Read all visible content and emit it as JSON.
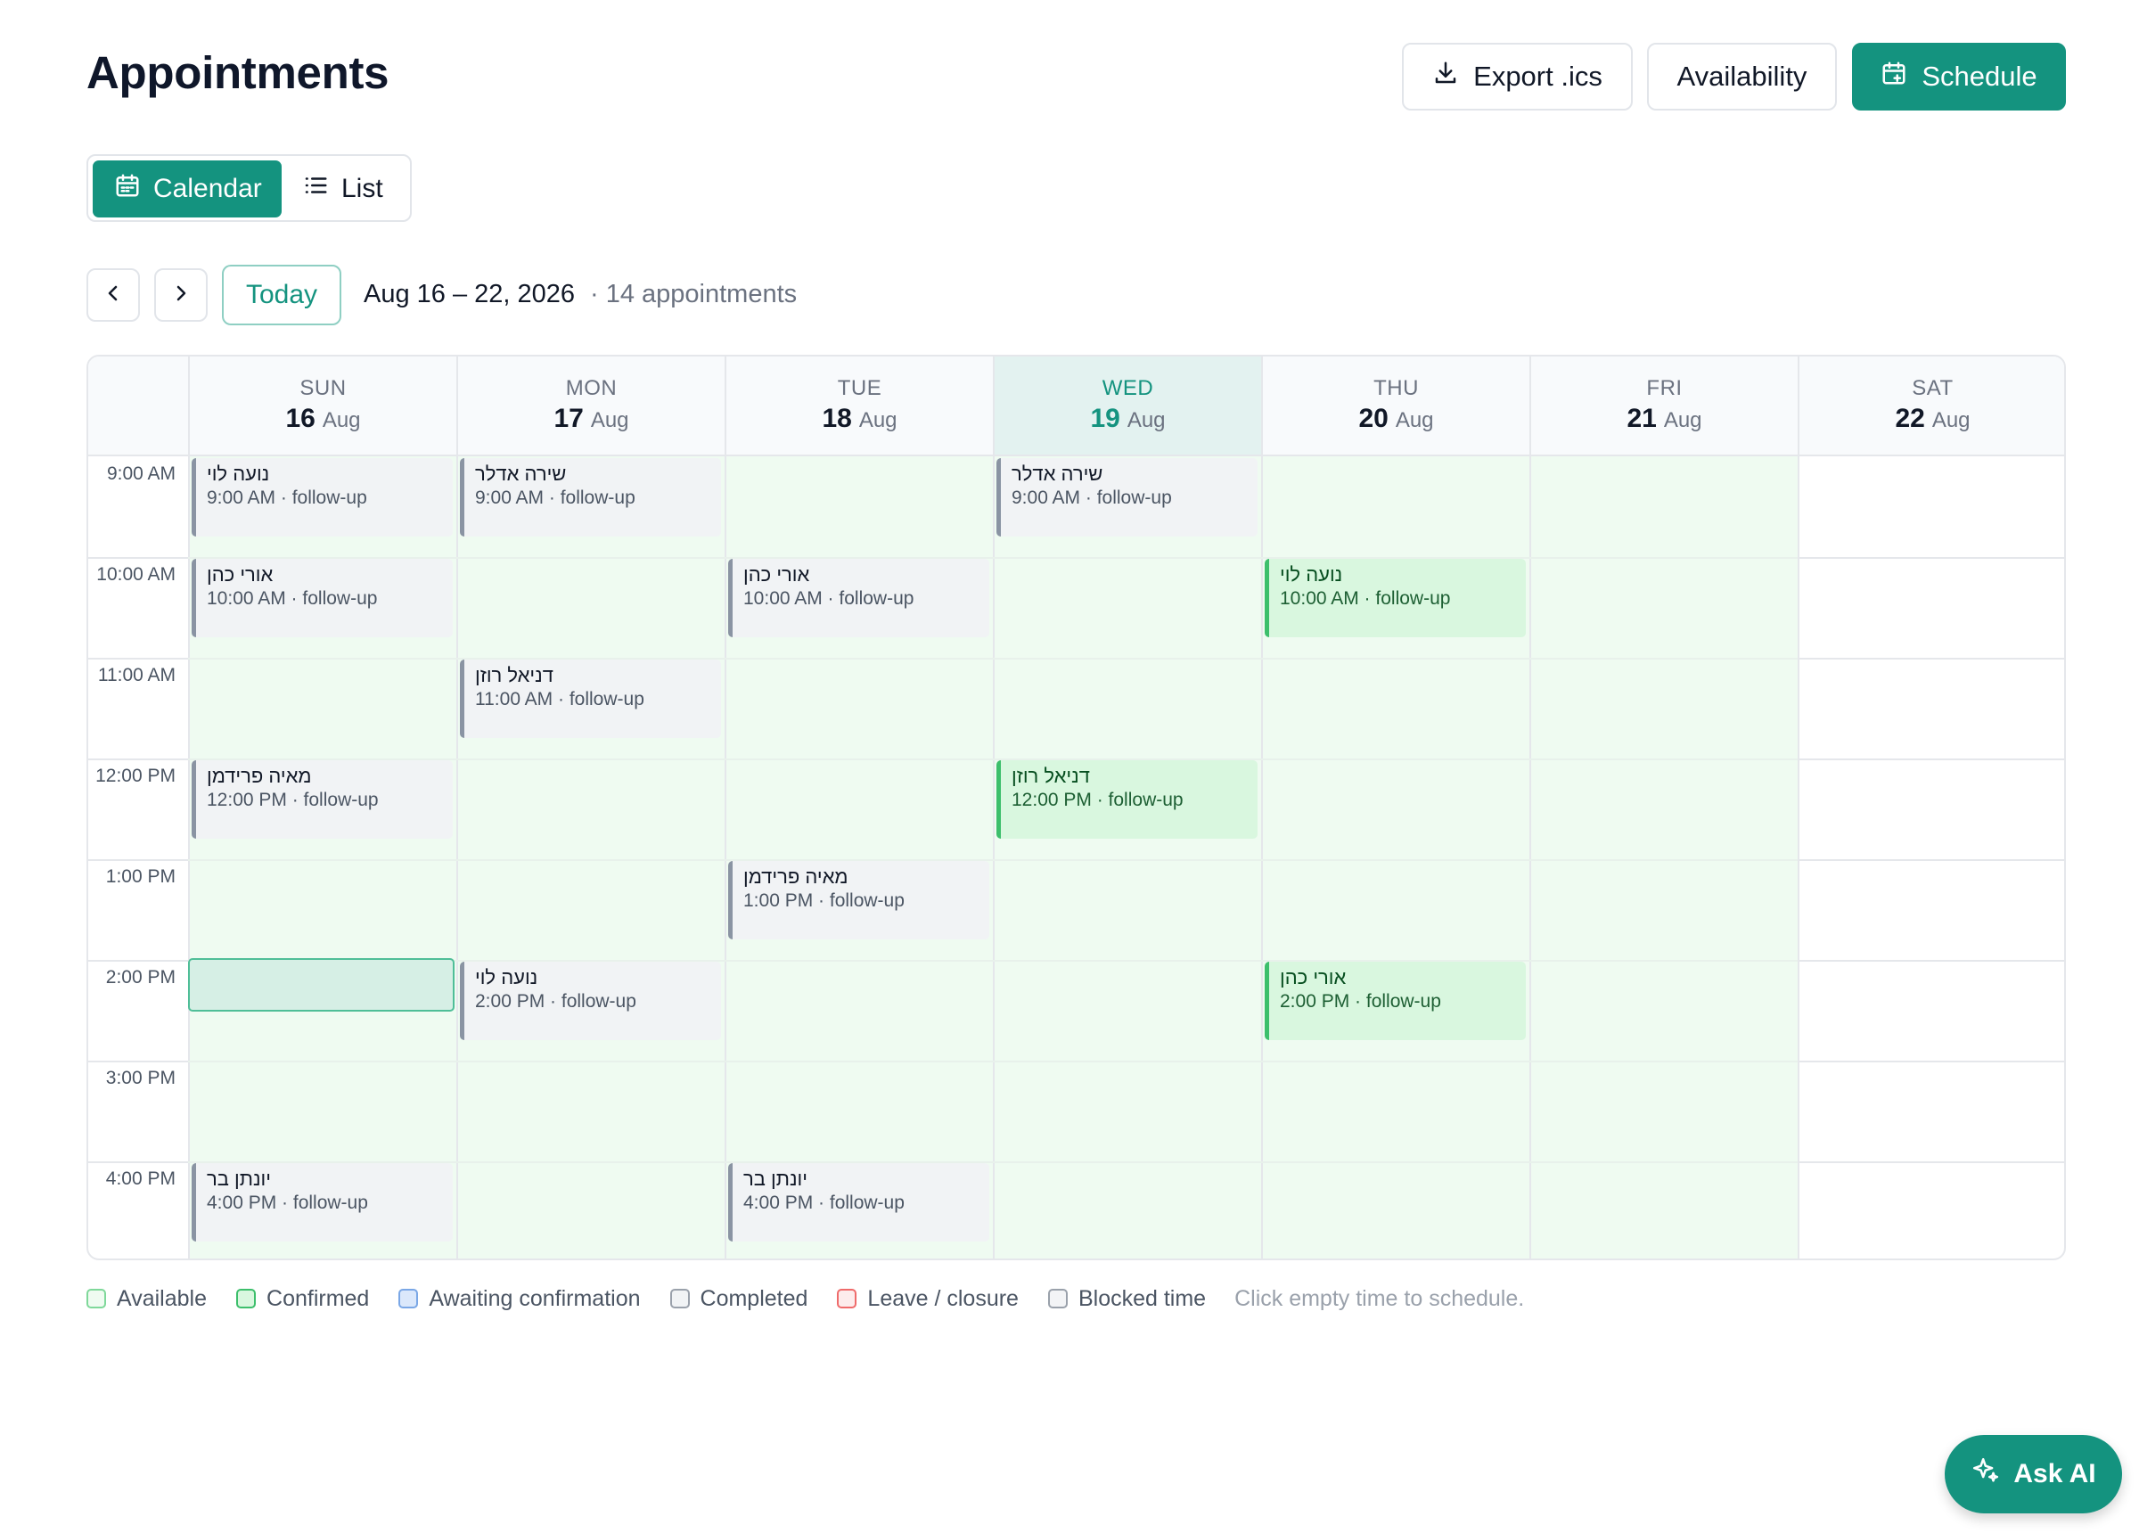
{
  "header": {
    "title": "Appointments",
    "export_label": "Export .ics",
    "availability_label": "Availability",
    "schedule_label": "Schedule"
  },
  "view_toggle": {
    "calendar_label": "Calendar",
    "list_label": "List",
    "active": "Calendar"
  },
  "toolbar": {
    "today_label": "Today",
    "range": "Aug 16 – 22, 2026",
    "count": "· 14 appointments"
  },
  "week": {
    "days": [
      {
        "dow": "SUN",
        "num": "16",
        "month": "Aug",
        "today": false,
        "available": true
      },
      {
        "dow": "MON",
        "num": "17",
        "month": "Aug",
        "today": false,
        "available": true
      },
      {
        "dow": "TUE",
        "num": "18",
        "month": "Aug",
        "today": false,
        "available": true
      },
      {
        "dow": "WED",
        "num": "19",
        "month": "Aug",
        "today": true,
        "available": true
      },
      {
        "dow": "THU",
        "num": "20",
        "month": "Aug",
        "today": false,
        "available": true
      },
      {
        "dow": "FRI",
        "num": "21",
        "month": "Aug",
        "today": false,
        "available": true
      },
      {
        "dow": "SAT",
        "num": "22",
        "month": "Aug",
        "today": false,
        "available": false
      }
    ],
    "hours": [
      "9:00 AM",
      "10:00 AM",
      "11:00 AM",
      "12:00 PM",
      "1:00 PM",
      "2:00 PM",
      "3:00 PM",
      "4:00 PM"
    ],
    "selected_slot": {
      "day": 0,
      "hour": 5
    }
  },
  "appointments": [
    {
      "day": 0,
      "hour": 0,
      "name": "נועה לוי",
      "time": "9:00 AM · follow-up",
      "status": "completed"
    },
    {
      "day": 0,
      "hour": 1,
      "name": "אורי כהן",
      "time": "10:00 AM · follow-up",
      "status": "completed"
    },
    {
      "day": 0,
      "hour": 3,
      "name": "מאיה פרידמן",
      "time": "12:00 PM · follow-up",
      "status": "completed"
    },
    {
      "day": 0,
      "hour": 7,
      "name": "יונתן בר",
      "time": "4:00 PM · follow-up",
      "status": "completed"
    },
    {
      "day": 1,
      "hour": 0,
      "name": "שירה אדלר",
      "time": "9:00 AM · follow-up",
      "status": "completed"
    },
    {
      "day": 1,
      "hour": 2,
      "name": "דניאל רוזן",
      "time": "11:00 AM · follow-up",
      "status": "completed"
    },
    {
      "day": 1,
      "hour": 5,
      "name": "נועה לוי",
      "time": "2:00 PM · follow-up",
      "status": "completed"
    },
    {
      "day": 2,
      "hour": 1,
      "name": "אורי כהן",
      "time": "10:00 AM · follow-up",
      "status": "completed"
    },
    {
      "day": 2,
      "hour": 4,
      "name": "מאיה פרידמן",
      "time": "1:00 PM · follow-up",
      "status": "completed"
    },
    {
      "day": 2,
      "hour": 7,
      "name": "יונתן בר",
      "time": "4:00 PM · follow-up",
      "status": "completed"
    },
    {
      "day": 3,
      "hour": 0,
      "name": "שירה אדלר",
      "time": "9:00 AM · follow-up",
      "status": "completed"
    },
    {
      "day": 3,
      "hour": 3,
      "name": "דניאל רוזן",
      "time": "12:00 PM · follow-up",
      "status": "confirmed"
    },
    {
      "day": 4,
      "hour": 1,
      "name": "נועה לוי",
      "time": "10:00 AM · follow-up",
      "status": "confirmed"
    },
    {
      "day": 4,
      "hour": 5,
      "name": "אורי כהן",
      "time": "2:00 PM · follow-up",
      "status": "confirmed"
    }
  ],
  "legend": {
    "items": [
      {
        "label": "Available",
        "border": "#7fd89a",
        "fill": "#effbf1"
      },
      {
        "label": "Confirmed",
        "border": "#3dbf6c",
        "fill": "#d9f7df"
      },
      {
        "label": "Awaiting confirmation",
        "border": "#7aa7e6",
        "fill": "#dbe8fb"
      },
      {
        "label": "Completed",
        "border": "#9aa1ab",
        "fill": "#f1f3f5"
      },
      {
        "label": "Leave / closure",
        "border": "#ef6b6b",
        "fill": "#fdecec"
      },
      {
        "label": "Blocked time",
        "border": "#9aa1ab",
        "fill": "#f3f4f6"
      }
    ],
    "hint": "Click empty time to schedule."
  },
  "ask_ai": {
    "label": "Ask AI"
  },
  "colors": {
    "accent": "#14937f",
    "available": "#effbf1",
    "today_header": "#e3f2f0"
  }
}
